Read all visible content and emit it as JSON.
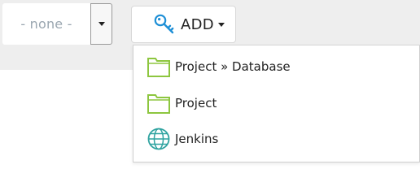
{
  "select": {
    "value": "- none -"
  },
  "add_button": {
    "label": "ADD",
    "icon": "key-icon"
  },
  "menu": {
    "items": [
      {
        "label": "Project » Database",
        "icon": "folder-icon"
      },
      {
        "label": "Project",
        "icon": "folder-icon"
      },
      {
        "label": "Jenkins",
        "icon": "globe-icon"
      }
    ]
  },
  "colors": {
    "toolbar_background": "#eeeeee",
    "folder_green": "#8dc63f",
    "globe_teal": "#2fa3a0",
    "key_blue": "#1e8fd6",
    "placeholder_text": "#9aa6b0"
  }
}
